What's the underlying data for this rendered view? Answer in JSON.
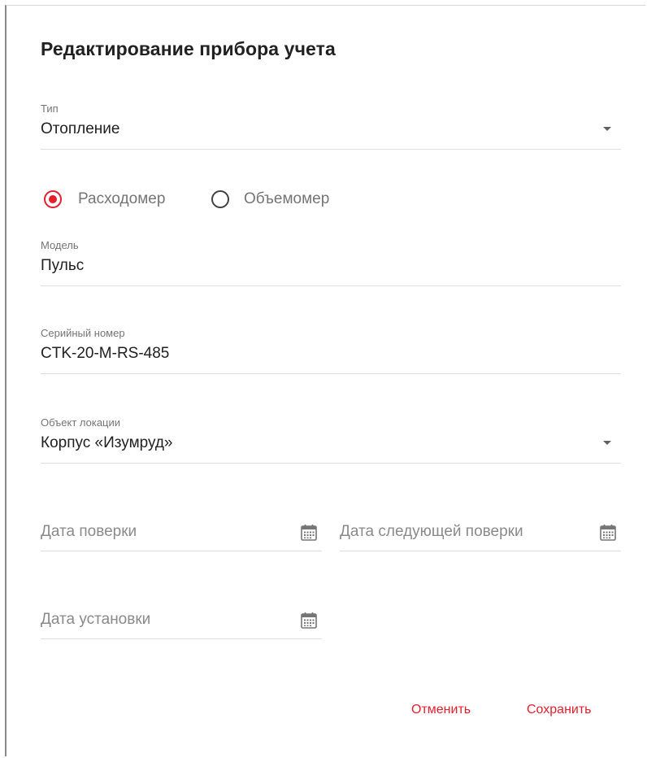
{
  "dialog": {
    "title": "Редактирование прибора учета"
  },
  "type_field": {
    "label": "Тип",
    "value": "Отопление",
    "icon": "dropdown-arrow-icon"
  },
  "meter_kind": {
    "options": [
      {
        "label": "Расходомер",
        "checked": true
      },
      {
        "label": "Объемомер",
        "checked": false
      }
    ]
  },
  "model_field": {
    "label": "Модель",
    "value": "Пульс"
  },
  "serial_field": {
    "label": "Серийный номер",
    "value": "CTK-20-M-RS-485"
  },
  "location_field": {
    "label": "Объект локации",
    "value": "Корпус «Изумруд»",
    "icon": "dropdown-arrow-icon"
  },
  "dates": {
    "verification_placeholder": "Дата поверки",
    "next_verification_placeholder": "Дата следующей поверки",
    "installation_placeholder": "Дата установки",
    "icon": "calendar-icon"
  },
  "actions": {
    "cancel_label": "Отменить",
    "save_label": "Сохранить"
  },
  "colors": {
    "accent": "#e5202e",
    "text": "#212121",
    "secondary_text": "#757575",
    "divider": "#dedede"
  }
}
